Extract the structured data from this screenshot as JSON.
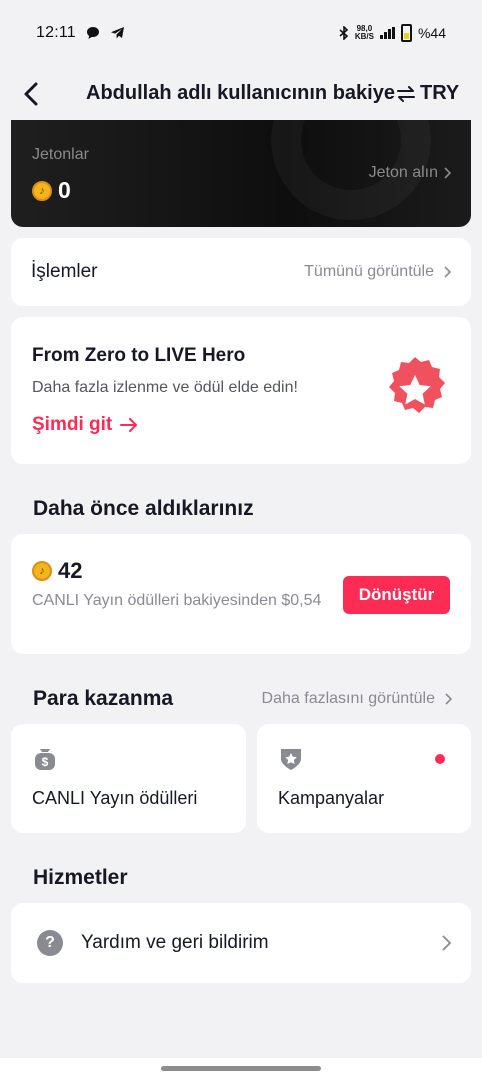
{
  "status_bar": {
    "time": "12:11",
    "net_speed_top": "98,0",
    "net_speed_unit": "KB/S",
    "battery": "%44"
  },
  "header": {
    "title": "Abdullah adlı kullanıcının bakiyesi",
    "currency": "TRY"
  },
  "coins": {
    "label": "Jetonlar",
    "value": "0",
    "link": "Jeton alın"
  },
  "transactions": {
    "label": "İşlemler",
    "more": "Tümünü görüntüle"
  },
  "promo": {
    "title": "From Zero to LIVE Hero",
    "subtitle": "Daha fazla izlenme ve ödül elde edin!",
    "link": "Şimdi git"
  },
  "previous": {
    "section_title": "Daha önce aldıklarınız",
    "amount": "42",
    "description": "CANLI Yayın ödülleri bakiyesinden $0,54",
    "button": "Dönüştür"
  },
  "earn": {
    "section_title": "Para kazanma",
    "more": "Daha fazlasını görüntüle",
    "tiles": [
      {
        "label": "CANLI Yayın ödülleri",
        "icon": "money-bag-icon"
      },
      {
        "label": "Kampanyalar",
        "icon": "shield-star-icon"
      }
    ]
  },
  "services": {
    "section_title": "Hizmetler",
    "help": "Yardım ve geri bildirim"
  },
  "colors": {
    "accent": "#fe2c55",
    "coin": "#f3b51b"
  }
}
